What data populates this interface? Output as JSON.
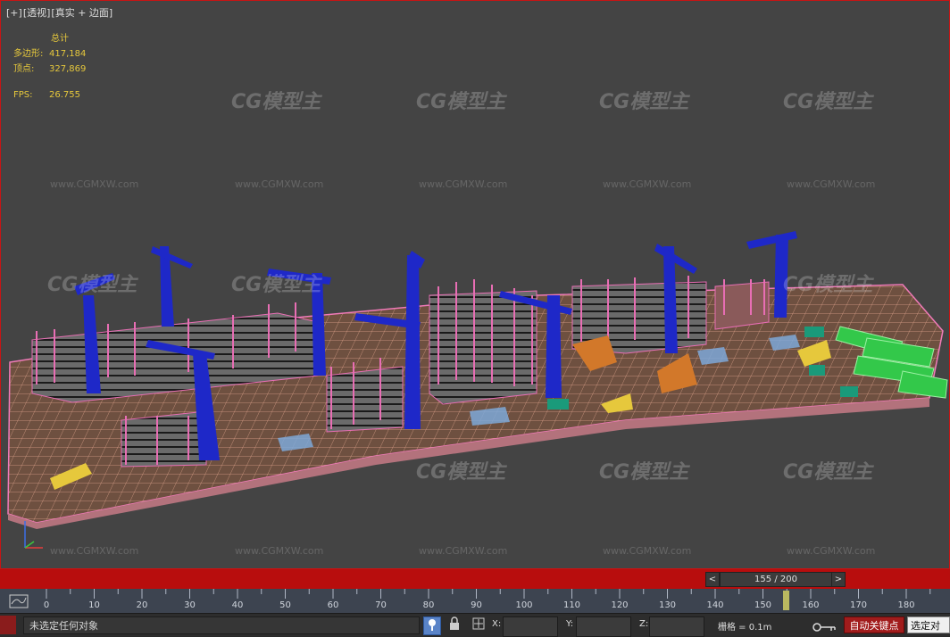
{
  "viewport": {
    "label_parts": [
      "[+]",
      "[透视]",
      "[真实 + 边面]"
    ],
    "stats": {
      "total_label": "总计",
      "poly_label": "多边形:",
      "poly_value": "417,184",
      "vert_label": "顶点:",
      "vert_value": "327,869",
      "fps_label": "FPS:",
      "fps_value": "26.755"
    },
    "watermark_logo": "CG模型主",
    "watermark_url": "www.CGMXW.com"
  },
  "timeslider": {
    "prev_label": "<",
    "next_label": ">",
    "frame_text": "155 / 200",
    "current_frame": 155,
    "total_frames": 200
  },
  "trackbar": {
    "ticks": [
      "0",
      "10",
      "20",
      "30",
      "40",
      "50",
      "60",
      "70",
      "80",
      "90",
      "100",
      "110",
      "120",
      "130",
      "140",
      "150",
      "160",
      "170",
      "180"
    ]
  },
  "statusbar": {
    "selection_text": "未选定任何对象",
    "x_label": "X:",
    "y_label": "Y:",
    "z_label": "Z:",
    "x_value": "",
    "y_value": "",
    "z_value": "",
    "grid_text": "栅格 = 0.1m",
    "autokey_label": "自动关键点",
    "set_label": "选定对"
  },
  "icons": {
    "track_icon": "curve-editor-icon",
    "pin": "isolate-pin-icon",
    "lock": "selection-lock-icon",
    "mode": "absolute-mode-icon",
    "key": "set-key-icon"
  },
  "colors": {
    "viewport_bg": "#444444",
    "highlight_border": "#c81414",
    "stats_text": "#e6c83c",
    "timebar_red": "#b80d0d",
    "autokey_red": "#a11c1c",
    "crane_blue": "#1e28c8",
    "wire_pink": "#e86eb4"
  }
}
